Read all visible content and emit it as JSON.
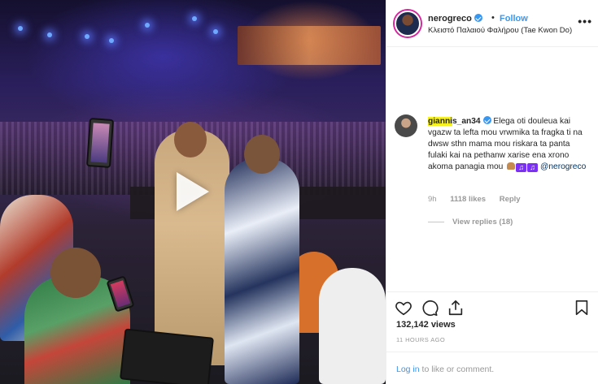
{
  "post": {
    "username": "nerogreco",
    "follow_label": "Follow",
    "separator": "•",
    "location": "Κλειστό Παλαιού Φαλήρου (Tae Kwon Do)",
    "more_label": "•••"
  },
  "comment": {
    "user_highlight": "gianni",
    "user_rest": "s_an34",
    "text": "Elega oti douleua kai vgazw ta lefta mou vrwmika ta fragka ti na dwsw sthn mama mou riskara ta panta fulaki kai na pethanw xarise ena xrono akoma panagia mou",
    "note_emoji": "♫",
    "mention": "@nerogreco",
    "time": "9h",
    "likes": "1118 likes",
    "reply_label": "Reply",
    "view_replies": "View replies (18)"
  },
  "actions": {
    "like_icon": "heart-icon",
    "comment_icon": "comment-icon",
    "share_icon": "share-icon",
    "save_icon": "bookmark-icon"
  },
  "stats": {
    "likes": "132,142 views",
    "timestamp": "11 HOURS AGO"
  },
  "footer": {
    "login_link": "Log in",
    "login_rest": " to like or comment."
  },
  "colors": {
    "accent": "#3897f0",
    "highlight": "#f7f21d"
  }
}
